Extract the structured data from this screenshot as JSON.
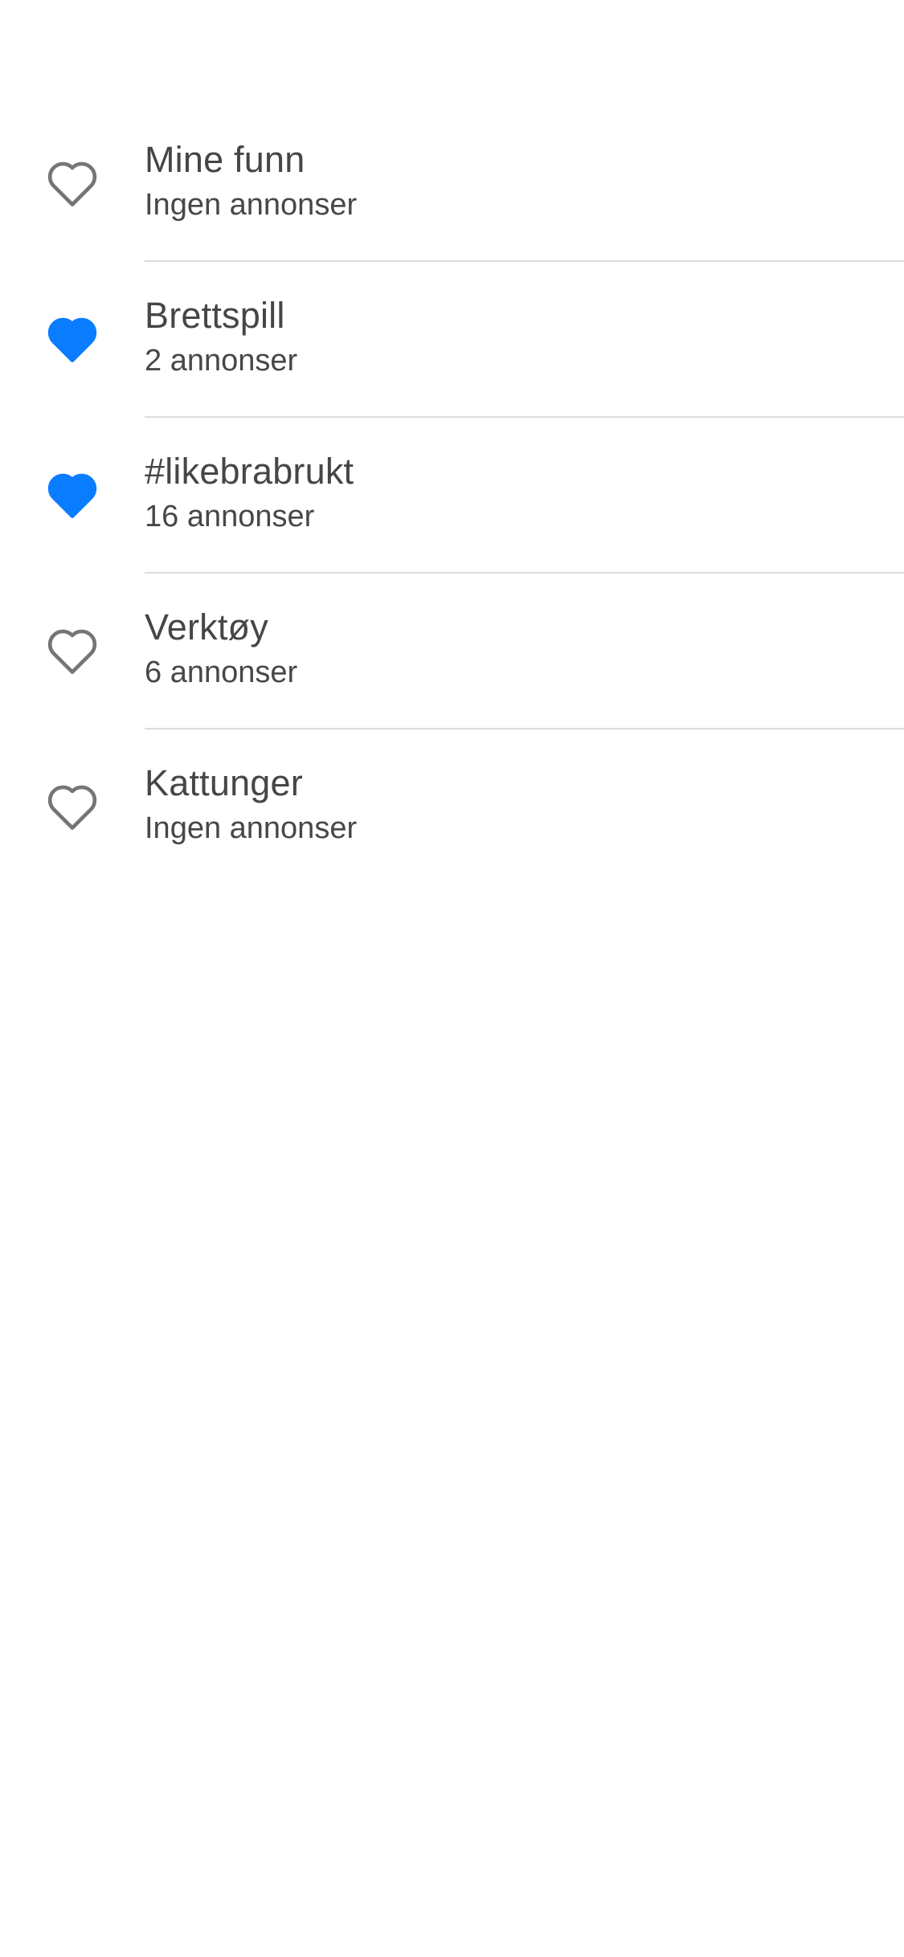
{
  "colors": {
    "accent": "#0a7cff",
    "outline": "#757575",
    "text": "#464646",
    "divider": "#dcdcdc"
  },
  "lists": [
    {
      "title": "Mine funn",
      "count": "Ingen annonser",
      "icon": "heart-outline-icon",
      "active": false
    },
    {
      "title": "Brettspill",
      "count": "2 annonser",
      "icon": "heart-filled-icon",
      "active": true
    },
    {
      "title": "#likebrabrukt",
      "count": "16 annonser",
      "icon": "heart-filled-icon",
      "active": true
    },
    {
      "title": "Verktøy",
      "count": "6 annonser",
      "icon": "heart-outline-icon",
      "active": false
    },
    {
      "title": "Kattunger",
      "count": "Ingen annonser",
      "icon": "heart-outline-icon",
      "active": false
    }
  ]
}
